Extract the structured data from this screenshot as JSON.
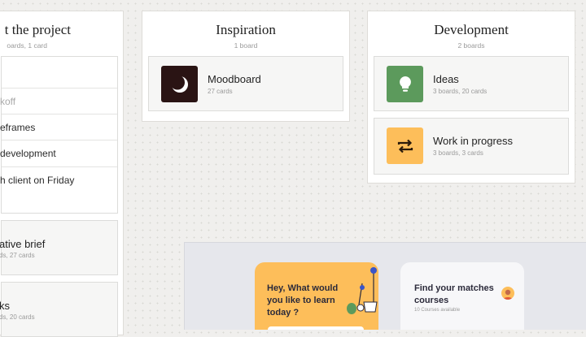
{
  "columns": {
    "left": {
      "title": "t the project",
      "subtitle": "oards, 1 card",
      "list": [
        "koff",
        "eframes",
        "development",
        "h client on Friday"
      ],
      "cards": [
        {
          "title": "ative brief",
          "meta": "ds, 27 cards"
        },
        {
          "title": "ks",
          "meta": "ds, 20 cards"
        }
      ]
    },
    "inspiration": {
      "title": "Inspiration",
      "subtitle": "1 board",
      "cards": [
        {
          "title": "Moodboard",
          "meta": "27 cards",
          "icon": "moon-icon",
          "color": "#2a1414"
        }
      ]
    },
    "development": {
      "title": "Development",
      "subtitle": "2 boards",
      "cards": [
        {
          "title": "Ideas",
          "meta": "3 boards, 20 cards",
          "icon": "lightbulb-icon",
          "color": "#5c9a5c"
        },
        {
          "title": "Work in progress",
          "meta": "3 boards, 3 cards",
          "icon": "repeat-icon",
          "color": "#fdbe5a"
        }
      ]
    }
  },
  "promo": {
    "question": "Hey, What would you like to learn today ?",
    "courses_title": "Find your matches courses",
    "courses_count": "10 Courses available"
  }
}
